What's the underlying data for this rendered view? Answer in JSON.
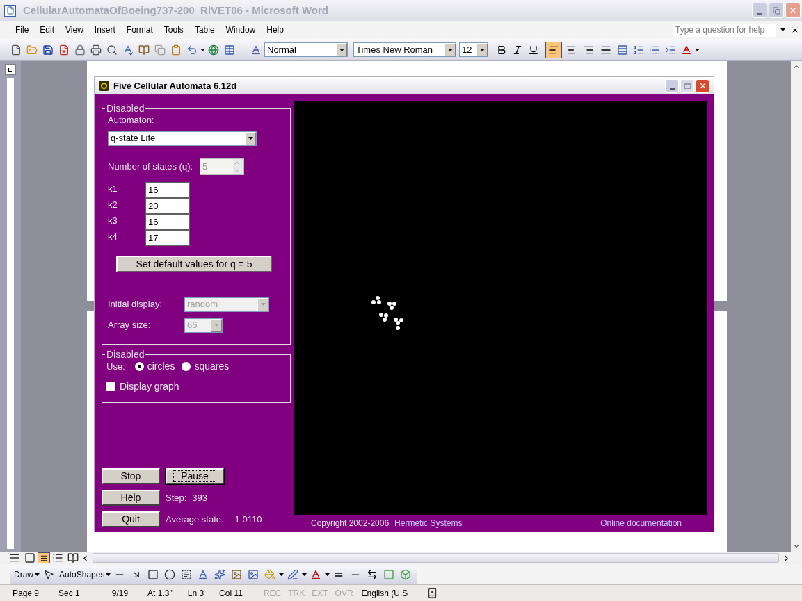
{
  "word": {
    "title": "CellularAutomataOfBoeing737-200_RiVET06 - Microsoft Word",
    "menu": [
      "File",
      "Edit",
      "View",
      "Insert",
      "Format",
      "Tools",
      "Table",
      "Window",
      "Help"
    ],
    "help_box": {
      "placeholder": "Type a question for help"
    },
    "style": "Normal",
    "font": "Times New Roman",
    "size": "12",
    "alignment": [
      {
        "selected": true
      },
      {
        "selected": false
      },
      {
        "selected": false
      },
      {
        "selected": false
      }
    ],
    "draw_menus": [
      "Draw",
      "AutoShapes"
    ],
    "status": [
      "Page 9",
      "Sec 1",
      "9/19",
      "At 1.3\"",
      "Ln 3",
      "Col 11"
    ],
    "indicators": [
      {
        "label": "REC",
        "on": false
      },
      {
        "label": "TRK",
        "on": false
      },
      {
        "label": "EXT",
        "on": false
      },
      {
        "label": "OVR",
        "on": false
      }
    ],
    "language": "English (U.S"
  },
  "app": {
    "title": "Five Cellular Automata 6.12d",
    "group1": {
      "legend": "Disabled",
      "automaton_label": "Automaton:",
      "automaton": "q-state Life",
      "states_label": "Number of states (q):",
      "states": {
        "value": "5",
        "disabled": true
      },
      "k": [
        {
          "label": "k1",
          "value": "16"
        },
        {
          "label": "k2",
          "value": "20"
        },
        {
          "label": "k3",
          "value": "16"
        },
        {
          "label": "k4",
          "value": "17"
        }
      ],
      "default_button": "Set default values for q =  5",
      "initial_label": "Initial display:",
      "initial": {
        "value": "random",
        "disabled": true
      },
      "array_label": "Array size:",
      "array": {
        "value": "66",
        "disabled": true
      }
    },
    "group2": {
      "legend": "Disabled",
      "use_label": "Use:",
      "shapes": [
        {
          "label": "circles",
          "selected": true
        },
        {
          "label": "squares",
          "selected": false
        }
      ],
      "graph": {
        "label": "Display graph",
        "checked": false
      }
    },
    "buttons": [
      {
        "label": "Stop",
        "focused": false
      },
      {
        "label": "Pause",
        "focused": true
      }
    ],
    "help_button": "Help",
    "quit_button": "Quit",
    "step": {
      "label": "Step:",
      "value": "393"
    },
    "average": {
      "label": "Average state:",
      "value": "1.0110"
    },
    "copyright": "Copyright 2002-2006",
    "company_link": "Hermetic Systems",
    "doc_link": "Online documentation"
  }
}
